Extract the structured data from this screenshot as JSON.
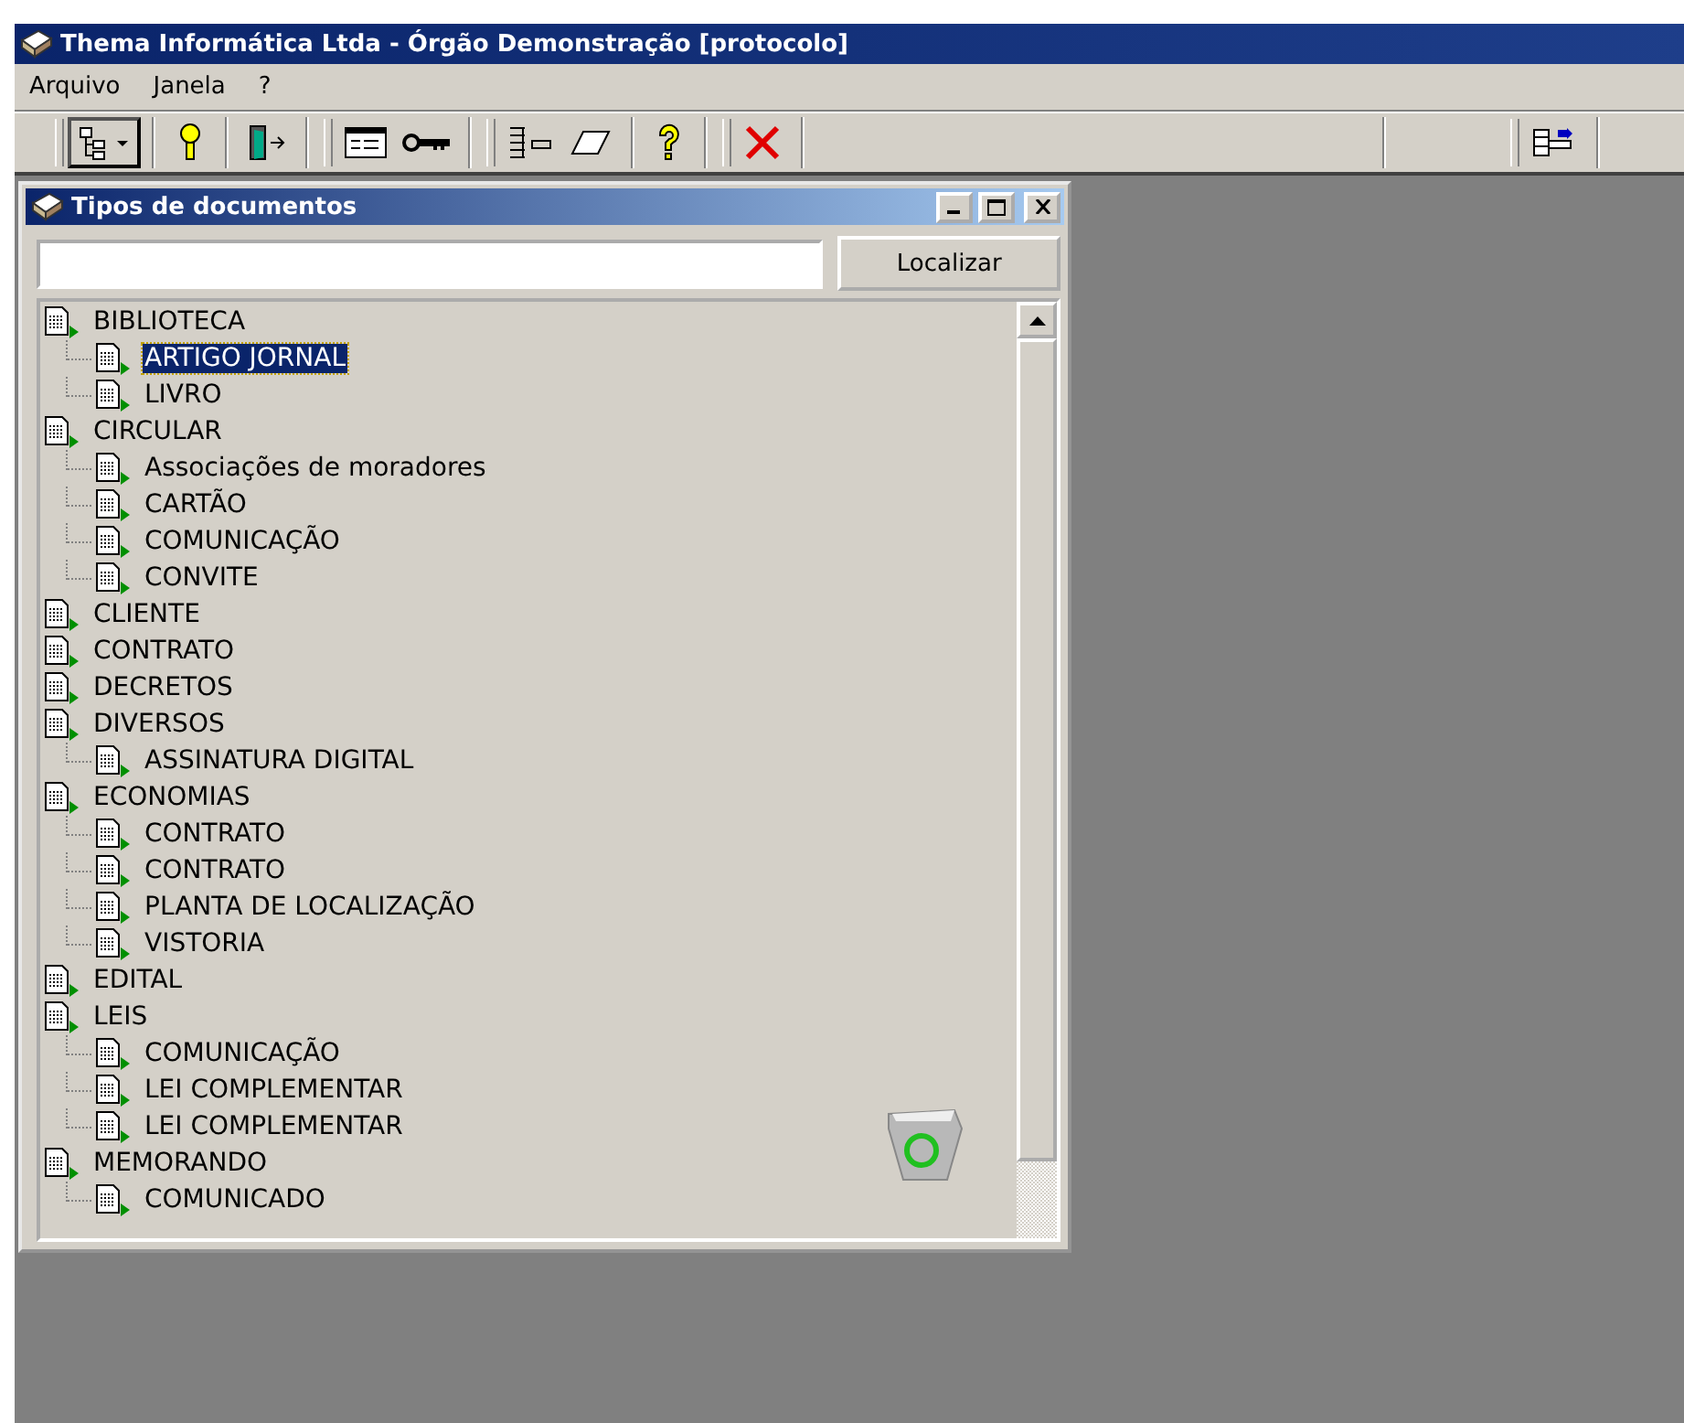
{
  "window": {
    "title": "Thema Informática Ltda - Órgão Demonstração [protocolo]"
  },
  "menu": [
    {
      "label": "Arquivo"
    },
    {
      "label": "Janela"
    },
    {
      "label": "?"
    }
  ],
  "child_window": {
    "title": "Tipos de documentos",
    "find_button": "Localizar",
    "tree": [
      {
        "label": "BIBLIOTECA",
        "selected": false,
        "children": [
          {
            "label": "ARTIGO JORNAL",
            "selected": true
          },
          {
            "label": "LIVRO",
            "selected": false
          }
        ]
      },
      {
        "label": "CIRCULAR",
        "selected": false,
        "children": [
          {
            "label": "Associações de moradores",
            "selected": false
          },
          {
            "label": "CARTÃO",
            "selected": false
          },
          {
            "label": "COMUNICAÇÃO",
            "selected": false
          },
          {
            "label": "CONVITE",
            "selected": false
          }
        ]
      },
      {
        "label": "CLIENTE",
        "selected": false
      },
      {
        "label": "CONTRATO",
        "selected": false
      },
      {
        "label": "DECRETOS",
        "selected": false
      },
      {
        "label": "DIVERSOS",
        "selected": false,
        "children": [
          {
            "label": "ASSINATURA DIGITAL",
            "selected": false
          }
        ]
      },
      {
        "label": "ECONOMIAS",
        "selected": false,
        "children": [
          {
            "label": "CONTRATO",
            "selected": false
          },
          {
            "label": "CONTRATO",
            "selected": false
          },
          {
            "label": "PLANTA DE LOCALIZAÇÃO",
            "selected": false
          },
          {
            "label": "VISTORIA",
            "selected": false
          }
        ]
      },
      {
        "label": "EDITAL",
        "selected": false
      },
      {
        "label": "LEIS",
        "selected": false,
        "children": [
          {
            "label": "COMUNICAÇÃO",
            "selected": false
          },
          {
            "label": "LEI COMPLEMENTAR",
            "selected": false
          },
          {
            "label": "LEI COMPLEMENTAR",
            "selected": false
          }
        ]
      },
      {
        "label": "MEMORANDO",
        "selected": false,
        "children": [
          {
            "label": "COMUNICADO",
            "selected": false
          }
        ]
      }
    ]
  }
}
